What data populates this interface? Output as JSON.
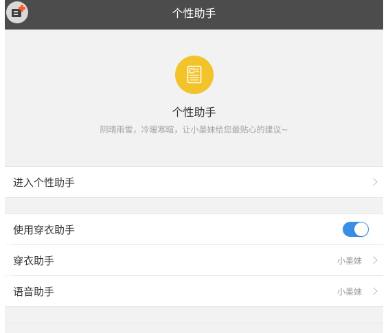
{
  "header": {
    "title": "个性助手",
    "app_button": {
      "icon": "doc-plus-icon",
      "accent": "#ff5a1f"
    }
  },
  "hero": {
    "icon": "newspaper-icon",
    "icon_color": "#f3c32a",
    "title": "个性助手",
    "subtitle": "阴晴雨雪，冷暖寒暄，让小墨妹给您最贴心的建议~"
  },
  "entry": {
    "label": "进入个性助手"
  },
  "settings": {
    "use_dressing": {
      "label": "使用穿衣助手",
      "enabled": true,
      "toggle_color": "#3a8ee6"
    },
    "dressing": {
      "label": "穿衣助手",
      "value": "小墨妹"
    },
    "voice": {
      "label": "语音助手",
      "value": "小墨妹"
    }
  }
}
